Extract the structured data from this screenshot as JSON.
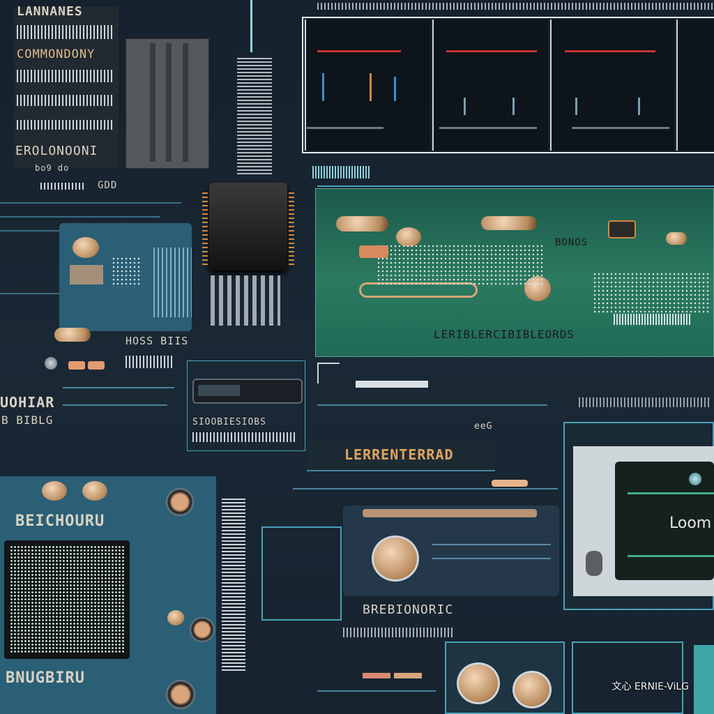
{
  "labels": {
    "top_left_heading": "LANNANES",
    "top_left_row2": "COMMONDONY",
    "top_left_row3": "EROLONOONI",
    "top_left_small": "bo9  do",
    "mid_left_code": "GDD",
    "green_board_right": "BONOS",
    "green_board_bottom": "LERIBLERCIBIBLEORDS",
    "left_board_code": "HOSS  BIIS",
    "left_heading_a": "UOHIAR",
    "left_heading_b": "B BIBLG",
    "center_connector": "SIOOBIESIOBS",
    "orange_banner": "LERRENTERRAD",
    "bottom_left_chip_label": "BEICHOURU",
    "bottom_left_footer": "BNUGBIRU",
    "bottom_center_label": "BREBIONORIC",
    "monitor_text": "Loom",
    "small_tag": "eeG"
  },
  "watermark": "文心 ERNIE-ViLG",
  "colors": {
    "background": "#152230",
    "board_teal": "#2a5f76",
    "board_green": "#2b7a5f",
    "copper": "#d9a57a",
    "accent_red": "#c8352f",
    "accent_orange": "#d38a3c",
    "text_light": "#d9d2c4"
  }
}
